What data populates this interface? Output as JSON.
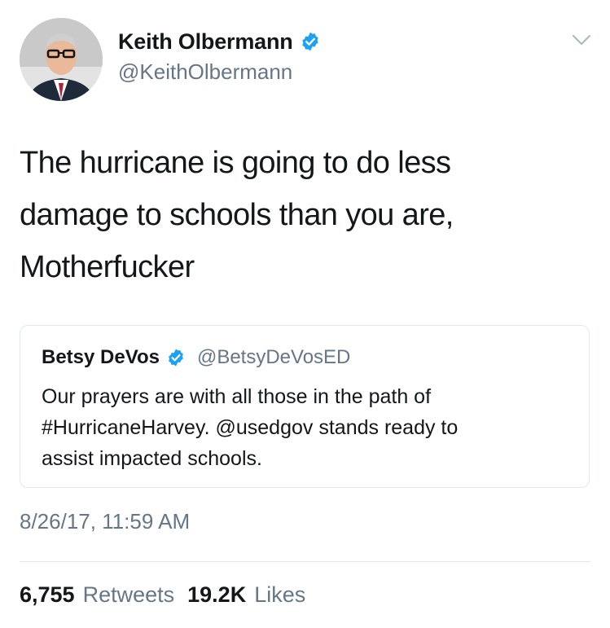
{
  "tweet": {
    "author": {
      "display_name": "Keith Olbermann",
      "handle": "@KeithOlbermann",
      "verified": true
    },
    "text_lines": [
      "The hurricane is going to do less",
      "damage to schools than you are,",
      "Motherfucker"
    ],
    "quoted_tweet": {
      "display_name": "Betsy DeVos",
      "handle": "@BetsyDeVosED",
      "verified": true,
      "text_lines": [
        "Our prayers are with all those in the path of",
        "#HurricaneHarvey. @usedgov stands ready to",
        "assist impacted schools."
      ]
    },
    "timestamp": "8/26/17, 11:59 AM",
    "stats": {
      "retweets_count": "6,755",
      "retweets_label": "Retweets",
      "likes_count": "19.2K",
      "likes_label": "Likes"
    }
  },
  "icons": {
    "verified": "verified-badge-icon",
    "menu": "chevron-down-icon"
  },
  "colors": {
    "verified_blue": "#1da1f2",
    "text_primary": "#14171a",
    "text_secondary": "#657786",
    "border": "#e1e8ed"
  }
}
